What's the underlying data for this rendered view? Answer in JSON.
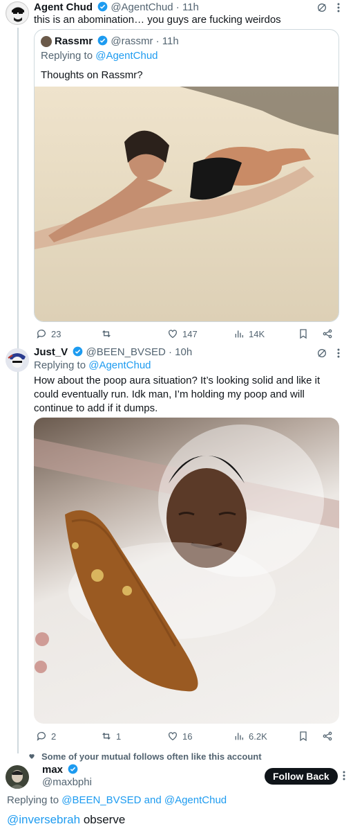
{
  "tweet1": {
    "name": "Agent Chud",
    "handle": "@AgentChud",
    "time": "· 11h",
    "text": "this is an abomination… you guys are fucking weirdos"
  },
  "quote": {
    "name": "Rassmr",
    "handle": "@rassmr",
    "time": "· 11h",
    "replying_prefix": "Replying to",
    "replying_handle": "@AgentChud",
    "text": "Thoughts on Rassmr?"
  },
  "tweet1_actions": {
    "replies": "23",
    "retweets": "",
    "likes": "147",
    "views": "14K"
  },
  "tweet2": {
    "name": "Just_V",
    "handle": "@BEEN_BVSED",
    "time": "· 10h",
    "replying_prefix": "Replying to",
    "replying_handle": "@AgentChud",
    "text_line1": "How about the poop aura situation? It’s looking solid and like it",
    "text_line2": "could eventually run. Idk man, I’m holding my poop and will",
    "text_line3": "continue to add if it dumps."
  },
  "tweet2_actions": {
    "replies": "2",
    "retweets": "1",
    "likes": "16",
    "views": "6.2K"
  },
  "suggestion": {
    "text": "Some of your mutual follows often like this account"
  },
  "tweet3": {
    "name": "max",
    "handle": "@maxbphi",
    "follow_label": "Follow Back",
    "replying_prefix": "Replying to",
    "replying_handles": "@BEEN_BVSED and @AgentChud",
    "mention": "@inversebrah",
    "text": " observe"
  },
  "colors": {
    "accent": "#1d9bf0",
    "muted": "#536471",
    "text": "#0f1419"
  }
}
